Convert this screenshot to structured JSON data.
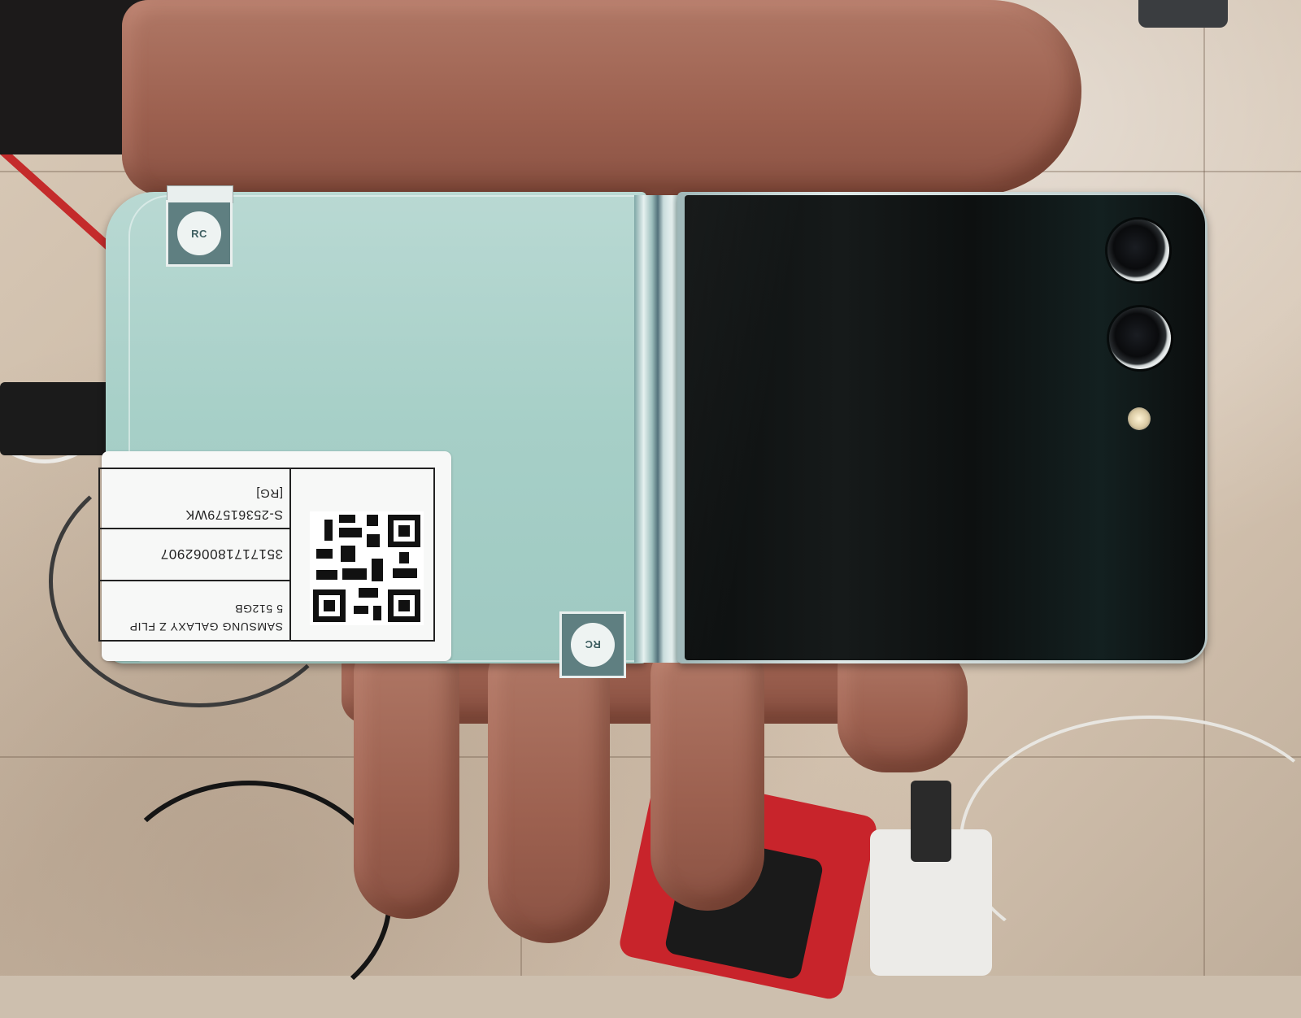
{
  "scene": {
    "description_free": true,
    "colors": {
      "device_back": "#a6cfc7",
      "cover_screen": "#0e1111",
      "frame": "#cfdcdb",
      "label_paper": "#f7f8f7",
      "floor": "#d0c0ad",
      "skin": "#a26a58"
    }
  },
  "label": {
    "line1": "S-25361579WK",
    "line0": "[RG]",
    "imei": "351717180062907",
    "model": "SAMSUNG GALAXY Z FLIP",
    "storage": "5   512GB"
  },
  "badges": {
    "mark": "RC"
  },
  "icons": {
    "qr": "qr-code-icon",
    "badge": "warranty-seal-icon"
  }
}
